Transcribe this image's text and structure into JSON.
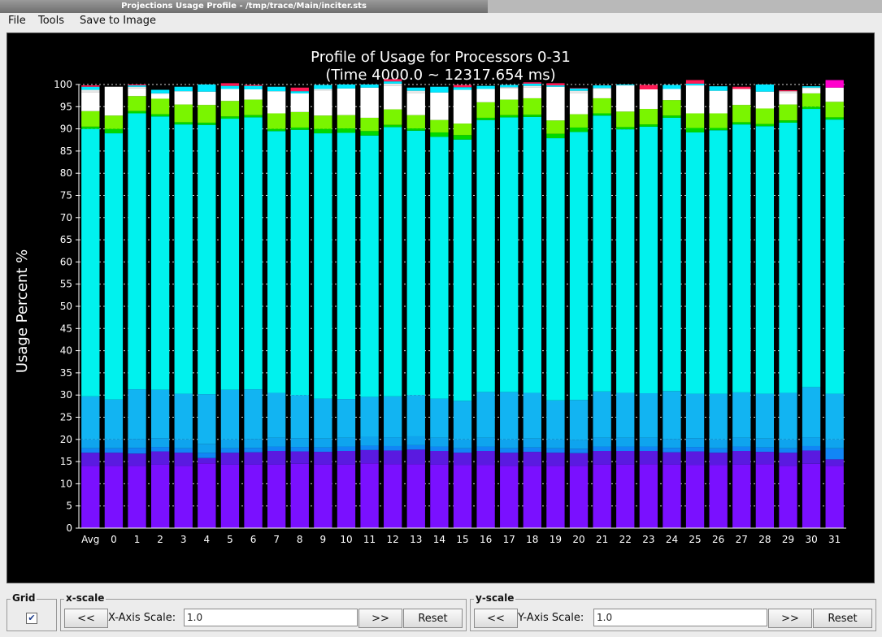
{
  "window": {
    "title": "Projections Usage Profile - /tmp/trace/Main/inciter.sts"
  },
  "menu": {
    "file": "File",
    "tools": "Tools",
    "save": "Save to Image"
  },
  "controls": {
    "grid_label": "Grid",
    "grid_checked": "✔",
    "xscale": {
      "legend": "x-scale",
      "prev": "<<",
      "label": "X-Axis Scale:",
      "value": "1.0",
      "next": ">>",
      "reset": "Reset"
    },
    "yscale": {
      "legend": "y-scale",
      "prev": "<<",
      "label": "Y-Axis Scale:",
      "value": "1.0",
      "next": ">>",
      "reset": "Reset"
    }
  },
  "chart_data": {
    "type": "bar",
    "stacked": true,
    "title": "Profile of Usage for Processors 0-31",
    "subtitle": "(Time 4000.0 ~ 12317.654 ms)",
    "xlabel": "",
    "ylabel": "Usage Percent %",
    "ylim": [
      0,
      100
    ],
    "yticks": [
      0,
      5,
      10,
      15,
      20,
      25,
      30,
      35,
      40,
      45,
      50,
      55,
      60,
      65,
      70,
      75,
      80,
      85,
      90,
      95,
      100
    ],
    "grid": true,
    "background": "#000000",
    "categories": [
      "Avg",
      "0",
      "1",
      "2",
      "3",
      "4",
      "5",
      "6",
      "7",
      "8",
      "9",
      "10",
      "11",
      "12",
      "13",
      "14",
      "15",
      "16",
      "17",
      "18",
      "19",
      "20",
      "21",
      "22",
      "23",
      "24",
      "25",
      "26",
      "27",
      "28",
      "29",
      "30",
      "31"
    ],
    "series": [
      {
        "color": "#7a10ff",
        "values": [
          14,
          14,
          14,
          14.3,
          14,
          14.6,
          14.3,
          14.3,
          14.3,
          14.5,
          14.3,
          14.3,
          14.6,
          14.4,
          14.4,
          14.3,
          14.2,
          14.2,
          14,
          14,
          14,
          14,
          14.3,
          14.3,
          14.4,
          14.3,
          14.2,
          14.2,
          14.3,
          14.4,
          14,
          14.5,
          14
        ]
      },
      {
        "color": "#5a1ae0",
        "values": [
          3,
          3,
          2.8,
          3,
          3,
          1.2,
          2.7,
          2.8,
          3.1,
          2.8,
          2.9,
          3.1,
          3,
          3.1,
          3.3,
          3.1,
          2.8,
          3.2,
          3,
          3.2,
          3,
          2.9,
          3.1,
          3.1,
          3,
          2.8,
          3.1,
          2.8,
          3.1,
          2.8,
          3,
          3,
          1.5
        ]
      },
      {
        "color": "#1186f5",
        "values": [
          1,
          1,
          1.3,
          1,
          1,
          1.2,
          1,
          1,
          1,
          1,
          1,
          1,
          1,
          1,
          1,
          1,
          1,
          1,
          1,
          1,
          1,
          1,
          1,
          1,
          1,
          1,
          1,
          1,
          1,
          1,
          1,
          1,
          2.5
        ]
      },
      {
        "color": "#0fa4ee",
        "values": [
          2,
          2,
          2,
          2,
          2,
          2,
          2,
          2,
          2,
          2,
          2,
          2,
          2,
          2,
          2,
          2,
          2,
          2,
          2,
          2,
          2,
          2,
          2,
          2,
          2,
          2,
          2,
          2,
          2,
          2,
          2,
          2,
          2
        ]
      },
      {
        "color": "#12b4f2",
        "values": [
          9.7,
          9,
          11.2,
          10.9,
          10.3,
          11.2,
          11.2,
          11.2,
          10.1,
          9.7,
          9,
          8.7,
          9,
          9.2,
          9.3,
          8.8,
          8.7,
          10.3,
          10.7,
          10.3,
          8.8,
          9,
          10.4,
          10.1,
          10,
          10.8,
          10,
          10.3,
          10.2,
          10.1,
          10.5,
          11.3,
          10.3
        ]
      },
      {
        "color": "#00f2ee",
        "values": [
          60.3,
          60,
          62.2,
          61.6,
          60.7,
          60.7,
          61.1,
          61.3,
          59,
          59.8,
          59.8,
          60,
          58.9,
          60.7,
          59.6,
          59,
          58.9,
          61.3,
          61.9,
          62.2,
          59.1,
          60.4,
          62.2,
          59.4,
          60.1,
          61.6,
          58.9,
          59.4,
          60.4,
          60.3,
          60.9,
          62.7,
          61.8
        ]
      },
      {
        "color": "#00d800",
        "values": [
          0.5,
          1,
          0.5,
          0.5,
          0.5,
          0.5,
          0.5,
          0.5,
          0.5,
          0.5,
          1,
          1,
          1,
          0.5,
          0.5,
          1,
          1,
          0.5,
          0.5,
          0.5,
          1,
          1,
          0.5,
          0.5,
          0.5,
          0.5,
          1,
          0.5,
          0.5,
          0.5,
          0.5,
          0.5,
          0.5
        ]
      },
      {
        "color": "#7af500",
        "values": [
          3.5,
          3,
          3.4,
          3.5,
          4,
          4,
          3.5,
          3.5,
          3.5,
          3.5,
          3,
          3,
          3,
          3.5,
          3,
          2.8,
          2.6,
          3.5,
          3.5,
          3.7,
          3,
          3,
          3.4,
          3.5,
          3.5,
          3.5,
          3.3,
          3.3,
          3.9,
          3.5,
          3.6,
          3,
          3.5
        ]
      },
      {
        "color": "#ffffff",
        "values": [
          4.3,
          6.5,
          1.7,
          1,
          3,
          3,
          2.7,
          2.3,
          5,
          4.2,
          5.7,
          6,
          6.8,
          5.3,
          5,
          6.2,
          7.6,
          3,
          2.5,
          2.5,
          7.6,
          4.8,
          2.1,
          5.9,
          4.4,
          2.5,
          6.3,
          5.1,
          3.6,
          3.8,
          2.5,
          1,
          3.2
        ]
      },
      {
        "color": "#e8e8e8",
        "values": [
          0.5,
          0,
          0.4,
          0.2,
          0,
          0,
          0,
          0,
          0,
          0,
          0.3,
          0,
          0,
          0.5,
          0.5,
          0,
          0,
          0,
          0.3,
          0.3,
          0,
          0.5,
          0.2,
          0,
          0,
          0,
          0,
          0,
          0,
          0,
          0.5,
          0.3,
          0
        ]
      },
      {
        "color": "#00e8ff",
        "values": [
          0.7,
          0,
          0.3,
          0.8,
          1,
          1.6,
          0.7,
          0.8,
          1,
          0.5,
          0.9,
          0.9,
          0.7,
          0.5,
          0.7,
          1.3,
          0.6,
          0.7,
          0.5,
          0.5,
          0.3,
          0.5,
          0.6,
          0.2,
          0,
          0.9,
          0.4,
          1,
          0,
          1.6,
          0,
          0.3,
          0
        ]
      },
      {
        "color": "#ff1a55",
        "values": [
          0.3,
          0,
          0.2,
          0,
          0,
          0,
          0.6,
          0.2,
          0,
          0.8,
          0,
          0,
          0,
          0.5,
          0,
          0,
          0.5,
          0,
          0,
          0.3,
          0.5,
          0.1,
          0,
          0,
          1,
          0,
          0.8,
          0,
          0.5,
          0,
          0.2,
          0,
          0
        ]
      },
      {
        "color": "#ff00cc",
        "values": [
          0,
          0,
          0,
          0,
          0,
          0,
          0,
          0,
          0,
          0,
          0,
          0,
          0,
          0,
          0,
          0,
          0,
          0,
          0,
          0,
          0,
          0,
          0,
          0,
          0,
          0,
          0,
          0,
          0,
          0,
          0,
          0,
          1.7
        ]
      }
    ]
  }
}
